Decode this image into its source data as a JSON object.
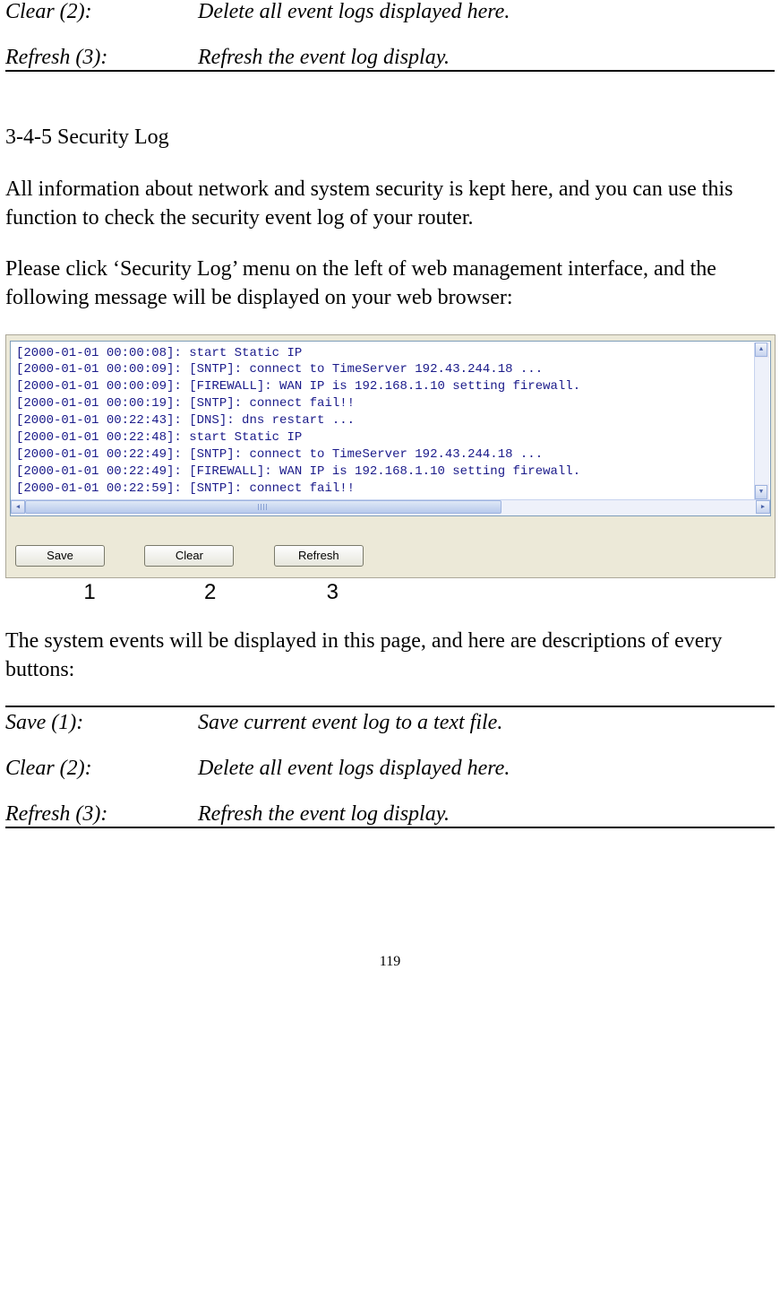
{
  "top_defs": {
    "clear_term": "Clear (2):",
    "clear_desc": "Delete all event logs displayed here.",
    "refresh_term": "Refresh (3):",
    "refresh_desc": "Refresh the event log display."
  },
  "section": {
    "heading": "3-4-5 Security Log",
    "para1": "All information about network and system security is kept here, and you can use this function to check the security event log of your router.",
    "para2": "Please click ‘Security Log’ menu on the left of web management interface, and the following message will be displayed on your web browser:"
  },
  "log_lines": [
    "[2000-01-01 00:00:08]: start Static IP",
    "[2000-01-01 00:00:09]: [SNTP]: connect to TimeServer 192.43.244.18 ...",
    "[2000-01-01 00:00:09]: [FIREWALL]: WAN IP is 192.168.1.10 setting firewall.",
    "[2000-01-01 00:00:19]: [SNTP]: connect fail!!",
    "[2000-01-01 00:22:43]: [DNS]: dns restart ...",
    "[2000-01-01 00:22:48]: start Static IP",
    "[2000-01-01 00:22:49]: [SNTP]: connect to TimeServer 192.43.244.18 ...",
    "[2000-01-01 00:22:49]: [FIREWALL]: WAN IP is 192.168.1.10 setting firewall.",
    "[2000-01-01 00:22:59]: [SNTP]: connect fail!!"
  ],
  "buttons": {
    "save": "Save",
    "clear": "Clear",
    "refresh": "Refresh"
  },
  "annotations": {
    "one": "1",
    "two": "2",
    "three": "3"
  },
  "after_shot": "The system events will be displayed in this page, and here are descriptions of every buttons:",
  "bottom_defs": {
    "save_term": "Save (1):",
    "save_desc": "Save current event log to a text file.",
    "clear_term": "Clear (2):",
    "clear_desc": "Delete all event logs displayed here.",
    "refresh_term": "Refresh (3):",
    "refresh_desc": "Refresh the event log display."
  },
  "page_number": "119"
}
